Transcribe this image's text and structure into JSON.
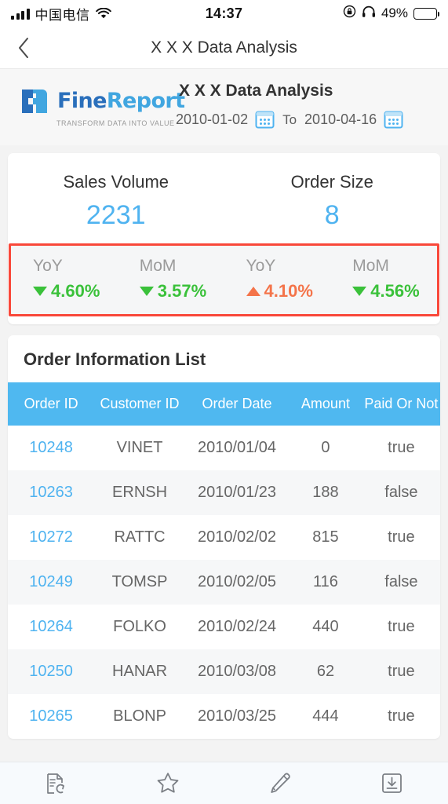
{
  "statusbar": {
    "carrier": "中国电信",
    "time": "14:37",
    "battery_pct": "49%",
    "signal_icon": "signal-bars-icon",
    "wifi_icon": "wifi-icon",
    "rotation_lock_icon": "rotation-lock-icon",
    "headphones_icon": "headphones-icon",
    "battery_icon": "battery-icon",
    "battery_level": 49
  },
  "navbar": {
    "back_icon": "chevron-left-icon",
    "title": "X X X Data Analysis"
  },
  "report_header": {
    "logo": {
      "name_a": "Fine",
      "name_b": "Report",
      "tagline": "TRANSFORM DATA INTO VALUE",
      "mark_icon": "finereport-logo-icon"
    },
    "title": "X X X Data Analysis",
    "date_from": "2010-01-02",
    "date_to_label": "To",
    "date_to": "2010-04-16",
    "calendar_icon": "calendar-icon"
  },
  "kpi": {
    "metrics": [
      {
        "label": "Sales Volume",
        "value": "2231"
      },
      {
        "label": "Order Size",
        "value": "8"
      }
    ],
    "deltas": [
      {
        "label": "YoY",
        "value": "4.60%",
        "direction": "down",
        "color": "#3ac13a"
      },
      {
        "label": "MoM",
        "value": "3.57%",
        "direction": "down",
        "color": "#3ac13a"
      },
      {
        "label": "YoY",
        "value": "4.10%",
        "direction": "up",
        "color": "#f4744a"
      },
      {
        "label": "MoM",
        "value": "4.56%",
        "direction": "down",
        "color": "#3ac13a"
      }
    ],
    "highlight_color": "#f9483a",
    "value_color": "#4fb3f0"
  },
  "order_table": {
    "title": "Order Information List",
    "columns": [
      "Order ID",
      "Customer ID",
      "Order Date",
      "Amount",
      "Paid Or Not"
    ],
    "header_bg": "#4fb8f0",
    "rows": [
      {
        "order_id": "10248",
        "customer_id": "VINET",
        "order_date": "2010/01/04",
        "amount": "0",
        "paid": "true"
      },
      {
        "order_id": "10263",
        "customer_id": "ERNSH",
        "order_date": "2010/01/23",
        "amount": "188",
        "paid": "false"
      },
      {
        "order_id": "10272",
        "customer_id": "RATTC",
        "order_date": "2010/02/02",
        "amount": "815",
        "paid": "true"
      },
      {
        "order_id": "10249",
        "customer_id": "TOMSP",
        "order_date": "2010/02/05",
        "amount": "116",
        "paid": "false"
      },
      {
        "order_id": "10264",
        "customer_id": "FOLKO",
        "order_date": "2010/02/24",
        "amount": "440",
        "paid": "true"
      },
      {
        "order_id": "10250",
        "customer_id": "HANAR",
        "order_date": "2010/03/08",
        "amount": "62",
        "paid": "true"
      },
      {
        "order_id": "10265",
        "customer_id": "BLONP",
        "order_date": "2010/03/25",
        "amount": "444",
        "paid": "true"
      }
    ]
  },
  "bottombar": {
    "items": [
      {
        "icon": "refresh-report-icon"
      },
      {
        "icon": "star-icon"
      },
      {
        "icon": "pencil-icon"
      },
      {
        "icon": "download-icon"
      }
    ]
  }
}
